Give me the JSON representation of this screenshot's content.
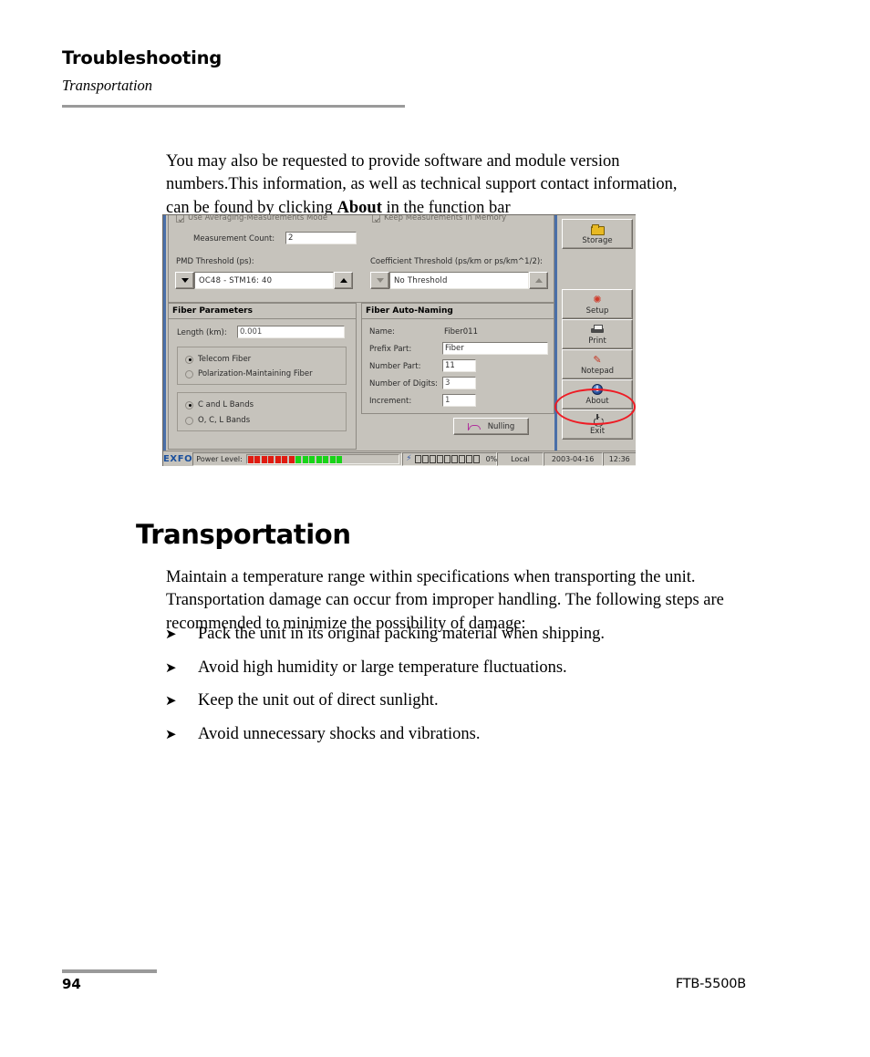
{
  "header": {
    "title": "Troubleshooting",
    "subtitle": "Transportation"
  },
  "intro": {
    "part1": "You may also be requested to provide software and module version numbers.This information, as well as technical support contact information, can be found by clicking ",
    "bold": "About",
    "part2": " in the function bar"
  },
  "section": {
    "heading": "Transportation",
    "paragraph": "Maintain a temperature range within specifications when transporting the unit. Transportation damage can occur from improper handling. The following steps are recommended to minimize the possibility of damage:"
  },
  "bullets": [
    {
      "glyph": "➤",
      "text": "Pack the unit in its original packing material when shipping."
    },
    {
      "glyph": "➤",
      "text": "Avoid high humidity or large temperature fluctuations."
    },
    {
      "glyph": "➤",
      "text": "Keep the unit out of direct sunlight."
    },
    {
      "glyph": "➤",
      "text": "Avoid unnecessary shocks and vibrations."
    }
  ],
  "footer": {
    "page_number": "94",
    "model": "FTB-5500B"
  },
  "screenshot": {
    "checkboxes": [
      {
        "label": "Use Averaging-Measurements Mode",
        "checked": true
      },
      {
        "label": "Keep Measurements in Memory",
        "checked": true
      }
    ],
    "measurement_count": {
      "label": "Measurement Count:",
      "value": "2"
    },
    "pmd_threshold": {
      "label": "PMD Threshold (ps):",
      "value": "OC48 - STM16: 40"
    },
    "coefficient_threshold": {
      "label": "Coefficient Threshold (ps/km or ps/km^1/2):",
      "value": "No Threshold"
    },
    "fiber_parameters": {
      "title": "Fiber Parameters",
      "length_label": "Length (km):",
      "length_value": "0.001",
      "fiber_type_options": [
        {
          "label": "Telecom Fiber",
          "selected": true
        },
        {
          "label": "Polarization-Maintaining Fiber",
          "selected": false
        }
      ],
      "band_options": [
        {
          "label": "C and L Bands",
          "selected": true
        },
        {
          "label": "O, C, L Bands",
          "selected": false
        }
      ]
    },
    "fiber_auto_naming": {
      "title": "Fiber Auto-Naming",
      "rows": [
        {
          "label": "Name:",
          "value": "Fiber011",
          "readonly": true
        },
        {
          "label": "Prefix Part:",
          "value": "Fiber",
          "readonly": false
        },
        {
          "label": "Number Part:",
          "value": "11",
          "readonly": false
        },
        {
          "label": "Number of Digits:",
          "value": "3",
          "readonly": false
        },
        {
          "label": "Increment:",
          "value": "1",
          "readonly": false
        }
      ]
    },
    "nulling_button": "Nulling",
    "function_bar": [
      {
        "label": "Storage",
        "icon": "folder-icon"
      },
      {
        "label": "Setup",
        "icon": "tools-icon"
      },
      {
        "label": "Print",
        "icon": "printer-icon"
      },
      {
        "label": "Notepad",
        "icon": "notepad-icon"
      },
      {
        "label": "About",
        "icon": "info-icon"
      },
      {
        "label": "Exit",
        "icon": "power-icon"
      }
    ],
    "status_bar": {
      "brand": "EXFO",
      "power_label": "Power Level:",
      "power_segments_red": 7,
      "power_segments_green": 7,
      "progress_percent": "0%",
      "progress_boxes": 9,
      "location": "Local",
      "date": "2003-04-16",
      "time": "12:36"
    },
    "annotation_color": "#ee1b24"
  }
}
